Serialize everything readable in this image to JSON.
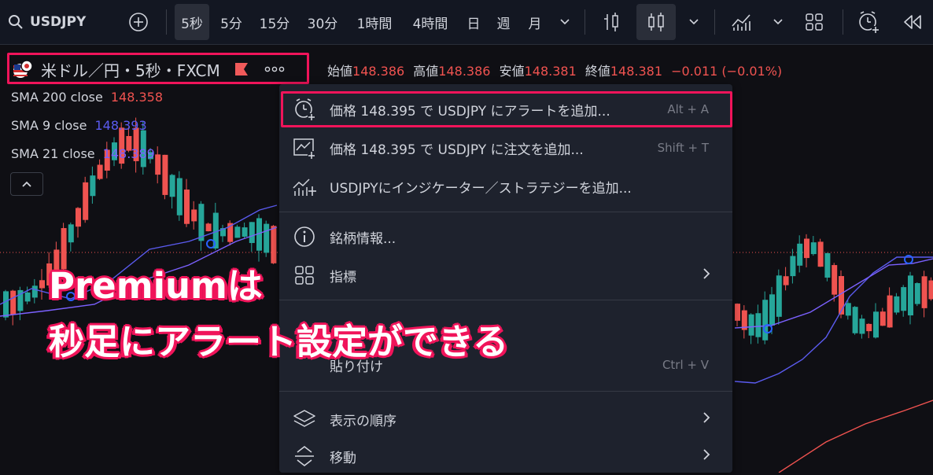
{
  "toolbar": {
    "symbol": "USDJPY",
    "intervals": [
      "5秒",
      "5分",
      "15分",
      "30分",
      "1時間",
      "4時間",
      "日",
      "週",
      "月"
    ],
    "active_interval": "5秒"
  },
  "header": {
    "symbol_title": "米ドル／円・5秒・FXCM",
    "ohlc": {
      "open_label": "始値",
      "open": "148.386",
      "high_label": "高値",
      "high": "148.386",
      "low_label": "安値",
      "low": "148.381",
      "close_label": "終値",
      "close": "148.381",
      "change": "−0.011 (−0.01%)"
    }
  },
  "indicators": [
    {
      "name": "SMA 200 close",
      "value": "148.358",
      "color": "#f05350"
    },
    {
      "name": "SMA 9 close",
      "value": "148.393",
      "color": "#5b5bf0"
    },
    {
      "name": "SMA 21 close",
      "value": "148.389",
      "color": "#7b61ff"
    }
  ],
  "context_menu": {
    "items": [
      {
        "label": "価格 148.395 で USDJPY にアラートを追加...",
        "shortcut": "Alt + A",
        "icon": "alarm-clock-plus-icon"
      },
      {
        "label": "価格 148.395 で USDJPY に注文を追加...",
        "shortcut": "Shift + T",
        "icon": "order-chart-icon"
      },
      {
        "label": "USDJPYにインジケーター／ストラテジーを追加...",
        "shortcut": "",
        "icon": "indicator-plus-icon"
      },
      {
        "label": "銘柄情報...",
        "shortcut": "",
        "icon": "info-icon"
      },
      {
        "label": "指標",
        "shortcut": "",
        "icon": "grid-icon"
      },
      {
        "label": "貼り付け",
        "shortcut": "Ctrl + V",
        "icon": ""
      },
      {
        "label": "表示の順序",
        "shortcut": "",
        "icon": "layers-icon"
      },
      {
        "label": "移動",
        "shortcut": "",
        "icon": "move-icon"
      }
    ]
  },
  "annotation": {
    "line1": "Premiumは",
    "line2": "秒足にアラート設定ができる",
    "color": "#f0145a"
  },
  "colors": {
    "up": "#26a69a",
    "down": "#ef5350",
    "background": "#0f0f14",
    "menu": "#1e222d"
  }
}
